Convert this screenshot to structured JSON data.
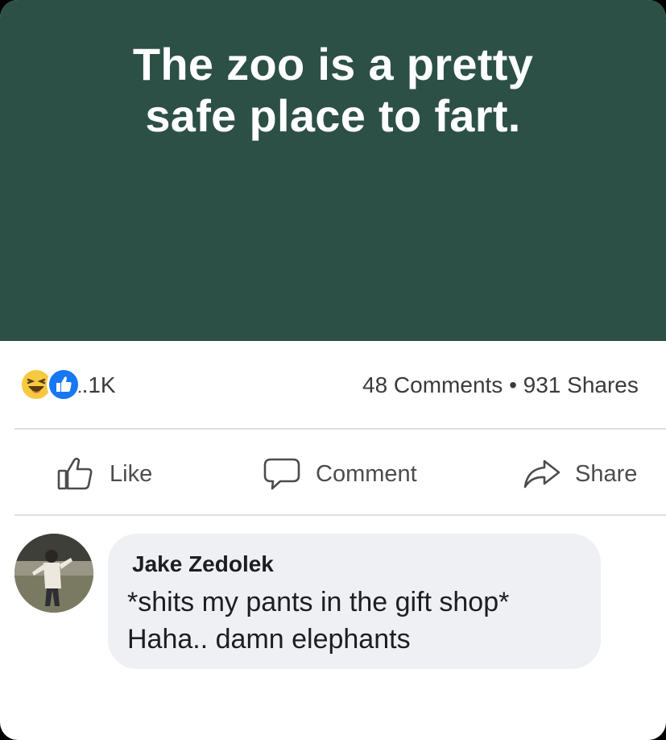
{
  "post": {
    "image_text_line_1": "The zoo is a pretty",
    "image_text_line_2": "safe place to fart.",
    "colors": {
      "banner": "#2d5046",
      "like_blue": "#1877f2",
      "haha_yellow": "#f7c940"
    }
  },
  "stats": {
    "reaction_icons": [
      "haha-icon",
      "like-icon"
    ],
    "reaction_count": "1.1K",
    "comments_shares": "48 Comments • 931 Shares"
  },
  "actions": {
    "like_label": "Like",
    "comment_label": "Comment",
    "share_label": "Share"
  },
  "comment": {
    "author": "Jake Zedolek",
    "line_1": "*shits my pants in the gift shop*",
    "line_2": "Haha.. damn elephants"
  }
}
